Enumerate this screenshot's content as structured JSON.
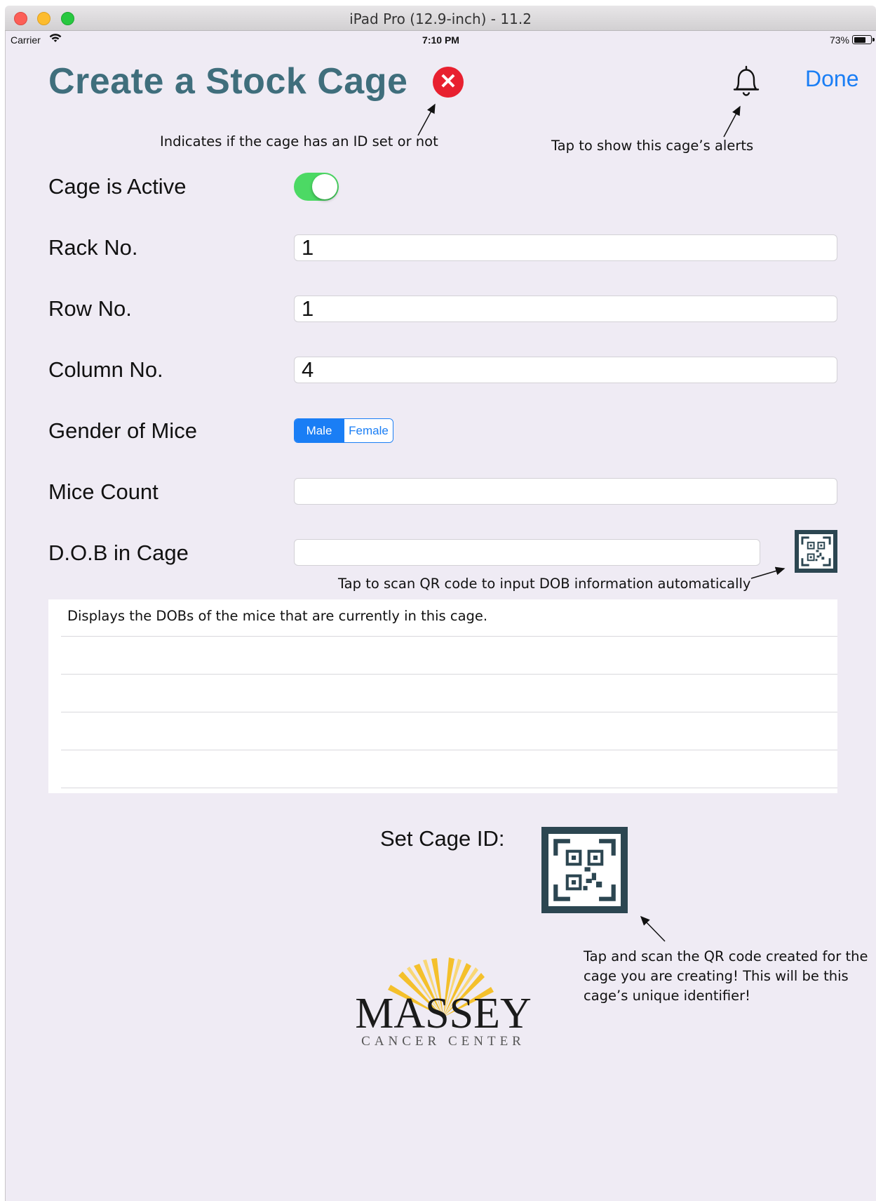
{
  "window": {
    "title": "iPad Pro (12.9-inch) - 11.2"
  },
  "status_bar": {
    "carrier": "Carrier",
    "time": "7:10 PM",
    "battery": "73%"
  },
  "header": {
    "title": "Create a Stock Cage",
    "done_label": "Done"
  },
  "annotations": {
    "id_indicator": "Indicates if the cage has an ID set or not",
    "alerts": "Tap to show this cage’s alerts",
    "scan_dob": "Tap to scan QR code to input DOB information automatically",
    "dob_table": "Displays the DOBs of the mice that are currently in this cage.",
    "set_id": "Tap and scan the QR code created for the cage you are creating! This will be this cage’s unique identifier!"
  },
  "form": {
    "active_label": "Cage is Active",
    "active_on": true,
    "rack_label": "Rack No.",
    "rack_value": "1",
    "row_label": "Row No.",
    "row_value": "1",
    "column_label": "Column No.",
    "column_value": "4",
    "gender_label": "Gender of Mice",
    "gender_options": [
      "Male",
      "Female"
    ],
    "gender_selected": "Male",
    "count_label": "Mice Count",
    "count_value": "",
    "dob_label": "D.O.B in Cage",
    "dob_value": ""
  },
  "set_cage_id_label": "Set Cage ID:",
  "logo": {
    "name": "MASSEY",
    "subtitle": "CANCER CENTER"
  },
  "icons": {
    "id_status": "close-circle-icon",
    "alerts": "bell-icon",
    "scan": "qr-code-icon"
  },
  "colors": {
    "title": "#3f6e7c",
    "accent": "#1a7ef5",
    "toggle_on": "#4cd964",
    "error": "#e8202f",
    "qr_frame": "#2c4651",
    "background": "#efebf4"
  }
}
